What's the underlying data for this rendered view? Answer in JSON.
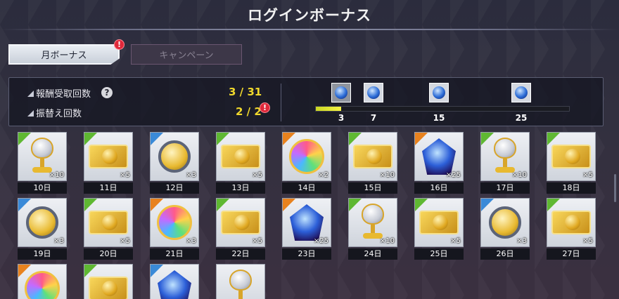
{
  "title": "ログインボーナス",
  "tabs": [
    {
      "label": "月ボーナス",
      "active": true,
      "badge": "!"
    },
    {
      "label": "キャンペーン",
      "active": false
    }
  ],
  "stats": {
    "received_label": "報酬受取回数",
    "received_value": "3 / 31",
    "reset_label": "振替え回数",
    "reset_value": "2 / 2",
    "help": "?",
    "badge": "!"
  },
  "progress": {
    "value_fraction": 0.1,
    "milestones": [
      {
        "num": "3",
        "claimed": true
      },
      {
        "num": "7",
        "claimed": false
      },
      {
        "num": "15",
        "claimed": false
      },
      {
        "num": "25",
        "claimed": false
      }
    ]
  },
  "colors": {
    "accent_yellow": "#f0d82c",
    "badge_red": "#e0283a",
    "green_rarity": "#5fb832",
    "blue_rarity": "#3a8ad8",
    "orange_rarity": "#e8821e"
  },
  "rewards": [
    {
      "day": "10日",
      "qty": "×10",
      "rarity": "green",
      "icon": "goblet-icon"
    },
    {
      "day": "11日",
      "qty": "×5",
      "rarity": "green",
      "icon": "ticket-icon"
    },
    {
      "day": "12日",
      "qty": "×3",
      "rarity": "blue",
      "icon": "coin-icon"
    },
    {
      "day": "13日",
      "qty": "×5",
      "rarity": "green",
      "icon": "ticket-icon"
    },
    {
      "day": "14日",
      "qty": "×2",
      "rarity": "orange",
      "icon": "rainbow-orb-icon"
    },
    {
      "day": "15日",
      "qty": "×10",
      "rarity": "green",
      "icon": "ticket-icon"
    },
    {
      "day": "16日",
      "qty": "×25",
      "rarity": "orange",
      "icon": "gem-icon"
    },
    {
      "day": "17日",
      "qty": "×10",
      "rarity": "green",
      "icon": "goblet-icon"
    },
    {
      "day": "18日",
      "qty": "×5",
      "rarity": "green",
      "icon": "ticket-icon"
    },
    {
      "day": "19日",
      "qty": "×3",
      "rarity": "blue",
      "icon": "coin-icon"
    },
    {
      "day": "20日",
      "qty": "×5",
      "rarity": "green",
      "icon": "ticket-icon"
    },
    {
      "day": "21日",
      "qty": "×3",
      "rarity": "orange",
      "icon": "rainbow-orb-icon"
    },
    {
      "day": "22日",
      "qty": "×5",
      "rarity": "green",
      "icon": "ticket-icon"
    },
    {
      "day": "23日",
      "qty": "×25",
      "rarity": "orange",
      "icon": "gem-icon"
    },
    {
      "day": "24日",
      "qty": "×10",
      "rarity": "green",
      "icon": "goblet-icon"
    },
    {
      "day": "25日",
      "qty": "×5",
      "rarity": "green",
      "icon": "ticket-icon"
    },
    {
      "day": "26日",
      "qty": "×3",
      "rarity": "blue",
      "icon": "coin-icon"
    },
    {
      "day": "27日",
      "qty": "×5",
      "rarity": "green",
      "icon": "ticket-icon"
    },
    {
      "day": "",
      "qty": "",
      "rarity": "orange",
      "icon": "rainbow-orb-icon"
    },
    {
      "day": "",
      "qty": "",
      "rarity": "green",
      "icon": "ticket-icon"
    },
    {
      "day": "",
      "qty": "",
      "rarity": "blue",
      "icon": "gem-icon"
    },
    {
      "day": "",
      "qty": "",
      "rarity": "none",
      "icon": "goblet-icon"
    }
  ]
}
